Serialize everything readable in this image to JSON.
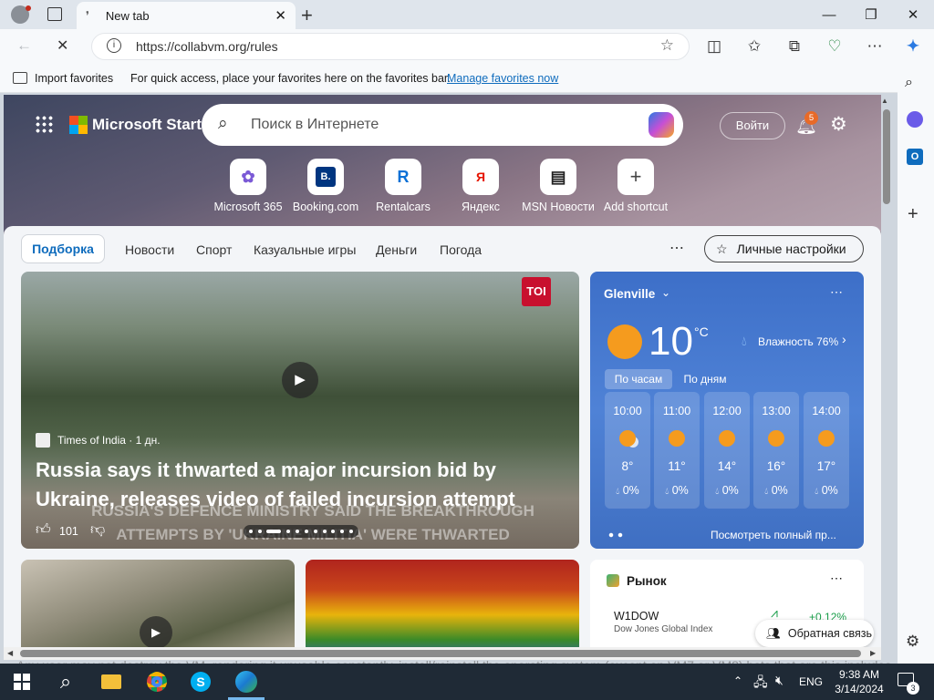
{
  "tab": {
    "title": "New tab"
  },
  "address": {
    "url": "https://collabvm.org/rules"
  },
  "favorites_bar": {
    "import_label": "Import favorites",
    "hint": "For quick access, place your favorites here on the favorites bar.",
    "manage_link": "Manage favorites now"
  },
  "msn": {
    "brand": "Microsoft Start",
    "search_placeholder": "Поиск в Интернете",
    "signin": "Войти",
    "notif_count": "5",
    "shortcuts": [
      {
        "label": "Microsoft 365",
        "icon": "365"
      },
      {
        "label": "Booking.com",
        "icon": "B."
      },
      {
        "label": "Rentalcars",
        "icon": "R"
      },
      {
        "label": "Яндекс",
        "icon": "Я"
      },
      {
        "label": "MSN Новости",
        "icon": "▤"
      },
      {
        "label": "Add shortcut",
        "icon": "+"
      }
    ],
    "nav": [
      "Подборка",
      "Новости",
      "Спорт",
      "Казуальные игры",
      "Деньги",
      "Погода"
    ],
    "personalize": "Личные настройки",
    "hero": {
      "source": "Times of India · 1 дн.",
      "badge": "TOI",
      "headline": "Russia says it thwarted a major incursion bid by Ukraine, releases video of failed incursion attempt",
      "likes": "101",
      "overlay_line1": "RUSSIA'S DEFENCE MINISTRY SAID THE BREAKTHROUGH",
      "overlay_line2": "ATTEMPTS BY 'UKRAINE MILITIA' WERE THWARTED"
    },
    "weather": {
      "city": "Glenville",
      "temp": "10",
      "unit": "°C",
      "humidity": "Влажность 76%",
      "tab_hourly": "По часам",
      "tab_daily": "По дням",
      "hours": [
        {
          "time": "10:00",
          "temp": "8°",
          "precip": "0%"
        },
        {
          "time": "11:00",
          "temp": "11°",
          "precip": "0%"
        },
        {
          "time": "12:00",
          "temp": "14°",
          "precip": "0%"
        },
        {
          "time": "13:00",
          "temp": "16°",
          "precip": "0%"
        },
        {
          "time": "14:00",
          "temp": "17°",
          "precip": "0%"
        }
      ],
      "full_link": "Посмотреть полный пр..."
    },
    "market": {
      "title": "Рынок",
      "ticker": "W1DOW",
      "change": "+0.12%",
      "index": "Dow Jones Global Index"
    },
    "feedback": "Обратная связь"
  },
  "behind_text": "Any user may not destroy the VM, rendering it unusable constantly, install/reinstall the operating system (except on VM7 or VM8) bots that are this includes bots that spam massive amounts of keyboard/mouse input (\"kitting\")",
  "taskbar": {
    "lang": "ENG",
    "time": "9:38 AM",
    "date": "3/14/2024",
    "notif": "3"
  },
  "colors": {
    "accent": "#0f6cbd",
    "weather_bg": "#4a7cd0",
    "taskbar": "#1f2a36"
  }
}
